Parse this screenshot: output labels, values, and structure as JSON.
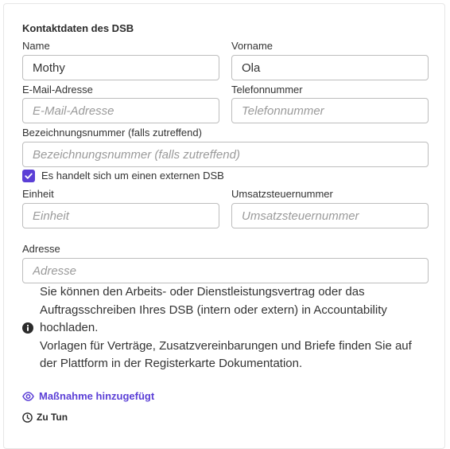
{
  "section": {
    "title": "Kontaktdaten des DSB"
  },
  "fields": {
    "name": {
      "label": "Name",
      "value": "Mothy",
      "placeholder": ""
    },
    "vorname": {
      "label": "Vorname",
      "value": "Ola",
      "placeholder": ""
    },
    "email": {
      "label": "E-Mail-Adresse",
      "value": "",
      "placeholder": "E-Mail-Adresse"
    },
    "telefon": {
      "label": "Telefonnummer",
      "value": "",
      "placeholder": "Telefonnummer"
    },
    "bezeichnung": {
      "label": "Bezeichnungsnummer (falls zutreffend)",
      "value": "",
      "placeholder": "Bezeichnungsnummer (falls zutreffend)"
    },
    "einheit": {
      "label": "Einheit",
      "value": "",
      "placeholder": "Einheit"
    },
    "ust": {
      "label": "Umsatzsteuernummer",
      "value": "",
      "placeholder": "Umsatzsteuernummer"
    },
    "adresse": {
      "label": "Adresse",
      "value": "",
      "placeholder": "Adresse"
    }
  },
  "external_checkbox": {
    "label": "Es handelt sich um einen externen DSB",
    "checked": true
  },
  "info": {
    "icon": "info-icon",
    "paragraph1": "Sie können den Arbeits- oder Dienstleistungsvertrag oder das Auftragsschreiben Ihres DSB (intern oder extern) in Accountability hochladen.",
    "paragraph2": "Vorlagen für Verträge, Zusatzvereinbarungen und Briefe finden Sie auf der Plattform in der Registerkarte Dokumentation."
  },
  "action": {
    "icon": "eye-icon",
    "label": "Maßnahme hinzugefügt"
  },
  "status": {
    "icon": "clock-icon",
    "label": "Zu Tun"
  },
  "colors": {
    "accent": "#5b3fd6",
    "border": "#bdbdbd",
    "placeholder": "#9a9a9a"
  }
}
